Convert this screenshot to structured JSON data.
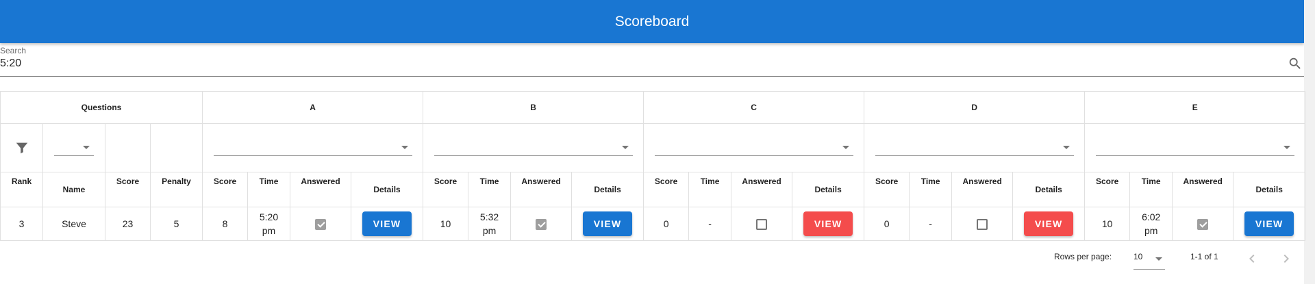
{
  "app": {
    "title": "Scoreboard"
  },
  "search": {
    "label": "Search",
    "value": "5:20",
    "icon": "search-icon"
  },
  "table": {
    "questions_header": "Questions",
    "problems": [
      "A",
      "B",
      "C",
      "D",
      "E"
    ],
    "fixed_columns": [
      "Rank",
      "Name",
      "Score",
      "Penalty"
    ],
    "problem_columns": [
      "Score",
      "Time",
      "Answered",
      "Details"
    ],
    "rows": [
      {
        "rank": "3",
        "name": "Steve",
        "score": "23",
        "penalty": "5",
        "problems": [
          {
            "score": "8",
            "time": "5:20 pm",
            "answered": true,
            "details": "VIEW",
            "color": "#1976d2"
          },
          {
            "score": "10",
            "time": "5:32 pm",
            "answered": true,
            "details": "VIEW",
            "color": "#1976d2"
          },
          {
            "score": "0",
            "time": "-",
            "answered": false,
            "details": "VIEW",
            "color": "#f44c4c"
          },
          {
            "score": "0",
            "time": "-",
            "answered": false,
            "details": "VIEW",
            "color": "#f44c4c"
          },
          {
            "score": "10",
            "time": "6:02 pm",
            "answered": true,
            "details": "VIEW",
            "color": "#1976d2"
          }
        ]
      }
    ]
  },
  "pagination": {
    "rows_per_page_label": "Rows per page:",
    "rows_per_page": "10",
    "range": "1-1 of 1"
  },
  "colors": {
    "primary": "#1976d2",
    "danger": "#f44c4c",
    "checked": "#9e9e9e"
  }
}
